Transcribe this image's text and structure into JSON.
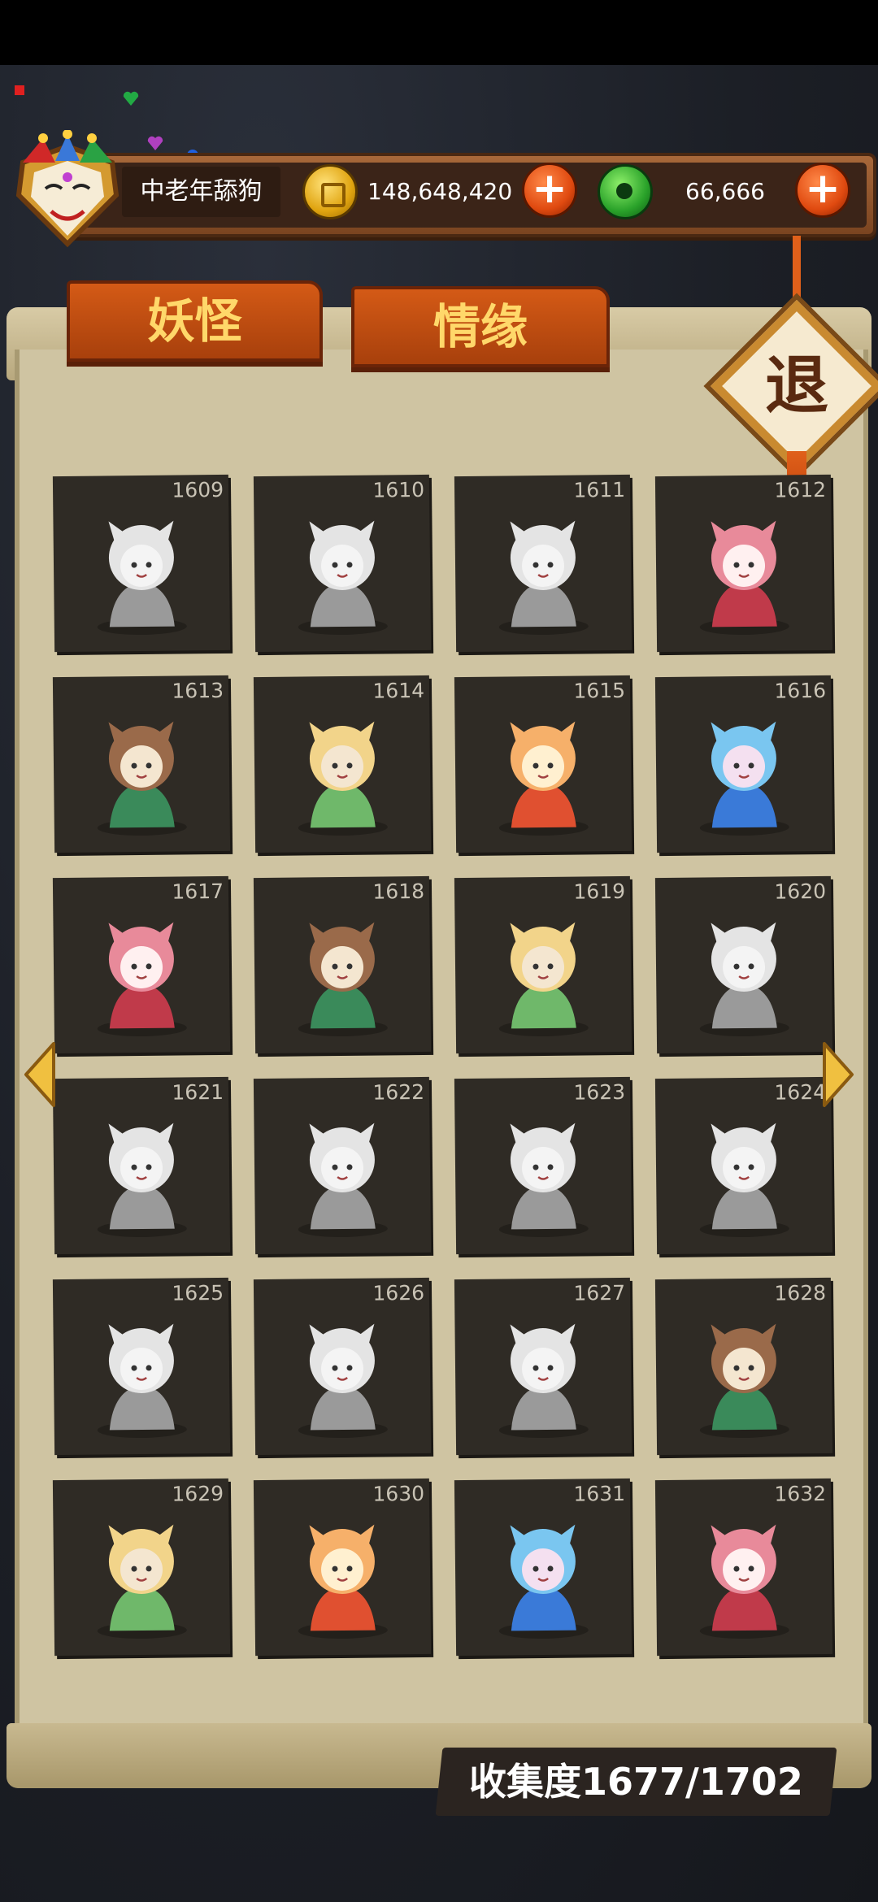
{
  "topbar": {
    "player_name": "中老年舔狗",
    "gold_amount": "148,648,420",
    "jade_amount": "66,666",
    "plus_label": "+"
  },
  "tabs": [
    {
      "label": "妖怪"
    },
    {
      "label": "情缘"
    }
  ],
  "exit_label": "退",
  "cards": [
    {
      "number": "1609",
      "locked": true,
      "icon": "girl-with-ribbon"
    },
    {
      "number": "1610",
      "locked": true,
      "icon": "harp-player"
    },
    {
      "number": "1611",
      "locked": true,
      "icon": "dragon-harp-spirit"
    },
    {
      "number": "1612",
      "locked": false,
      "icon": "bunny-on-stump"
    },
    {
      "number": "1613",
      "locked": false,
      "icon": "fox-girl-flute"
    },
    {
      "number": "1614",
      "locked": false,
      "icon": "fox-girl-flute-standing"
    },
    {
      "number": "1615",
      "locked": false,
      "icon": "fox-spirit-sun"
    },
    {
      "number": "1616",
      "locked": false,
      "icon": "ghost-with-shell"
    },
    {
      "number": "1617",
      "locked": false,
      "icon": "sleeping-fairy-shell"
    },
    {
      "number": "1618",
      "locked": false,
      "icon": "fairy-with-shell"
    },
    {
      "number": "1619",
      "locked": false,
      "icon": "water-fairy"
    },
    {
      "number": "1620",
      "locked": true,
      "icon": "ghost-pan-flute"
    },
    {
      "number": "1621",
      "locked": true,
      "icon": "boy-pan-flute"
    },
    {
      "number": "1622",
      "locked": true,
      "icon": "cherub-pan-flute"
    },
    {
      "number": "1623",
      "locked": true,
      "icon": "winged-god"
    },
    {
      "number": "1624",
      "locked": true,
      "icon": "ghost-stick"
    },
    {
      "number": "1625",
      "locked": true,
      "icon": "horned-lamb"
    },
    {
      "number": "1626",
      "locked": true,
      "icon": "horned-girl-smoke"
    },
    {
      "number": "1627",
      "locked": true,
      "icon": "dragon-lady"
    },
    {
      "number": "1628",
      "locked": false,
      "icon": "heart-playing-card"
    },
    {
      "number": "1629",
      "locked": false,
      "icon": "top-hat-girl"
    },
    {
      "number": "1630",
      "locked": false,
      "icon": "magician-sword"
    },
    {
      "number": "1631",
      "locked": false,
      "icon": "kimono-granny"
    },
    {
      "number": "1632",
      "locked": false,
      "icon": "pink-hair-girl"
    }
  ],
  "collection_text": "收集度1677/1702",
  "colors": {
    "tab_orange": "#c84e12",
    "tab_text": "#ffd86a",
    "card_bg": "#2f2b25",
    "parchment": "#cfc4a2"
  }
}
